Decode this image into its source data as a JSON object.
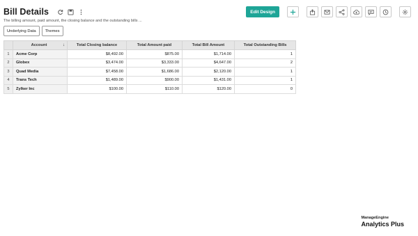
{
  "report": {
    "title": "Bill Details",
    "subtitle": "The billing amount, paid amount, the closing balance and the outstanding bills ..."
  },
  "toolbar": {
    "edit_label": "Edit Design",
    "icons": [
      "plus-icon",
      "export-icon",
      "email-icon",
      "share-icon",
      "publish-icon",
      "comment-icon",
      "schedule-icon",
      "settings-icon"
    ]
  },
  "tabs": [
    {
      "label": "Underlying Data"
    },
    {
      "label": "Themes"
    }
  ],
  "table": {
    "columns": [
      "Account",
      "Total Closing balance",
      "Total Amount paid",
      "Total Bill Amount",
      "Total Outstanding Bills"
    ],
    "sort_indicator": "↓",
    "rows": [
      {
        "index": "1",
        "account": "Acme Corp",
        "closing": "$8,492.00",
        "paid": "$875.00",
        "bill": "$1,714.00",
        "outstanding": "1"
      },
      {
        "index": "2",
        "account": "Globex",
        "closing": "$3,474.00",
        "paid": "$3,333.00",
        "bill": "$4,647.00",
        "outstanding": "2"
      },
      {
        "index": "3",
        "account": "Quad Media",
        "closing": "$7,458.00",
        "paid": "$1,686.00",
        "bill": "$2,120.00",
        "outstanding": "1"
      },
      {
        "index": "4",
        "account": "Trans Tech",
        "closing": "$1,489.00",
        "paid": "$900.00",
        "bill": "$1,431.00",
        "outstanding": "1"
      },
      {
        "index": "5",
        "account": "Zylker Inc",
        "closing": "$100.00",
        "paid": "$110.00",
        "bill": "$120.00",
        "outstanding": "0"
      }
    ]
  },
  "brand": {
    "top": "ManageEngine",
    "bottom": "Analytics Plus"
  },
  "colors": {
    "accent": "#1ea597"
  }
}
